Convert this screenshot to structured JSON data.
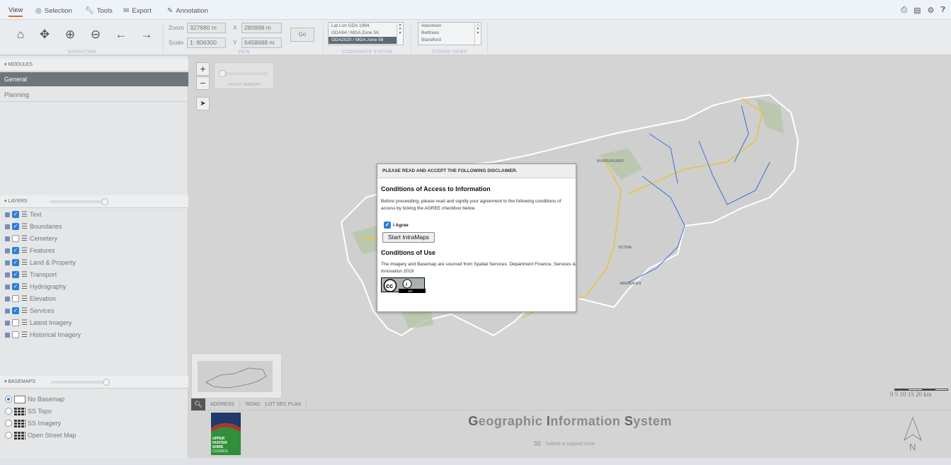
{
  "menu": {
    "items": [
      "View",
      "Selection",
      "Tools",
      "Export",
      "Annotation"
    ],
    "top_icons": [
      "print-icon",
      "clipboard-icon",
      "settings-icon",
      "help-icon"
    ]
  },
  "toolbar": {
    "navigation_caption": "NAVIGATION",
    "view_caption": "VIEW",
    "coord_caption": "COORDINATE SYSTEM",
    "stored_caption": "STORED VIEWS",
    "zoom_label": "Zoom",
    "zoom_value": "327680 m",
    "scale_label": "Scale",
    "scale_value": "1: 806300",
    "x_label": "X",
    "x_value": "280998 m",
    "y_label": "Y",
    "y_value": "6458688 m",
    "go_label": "Go",
    "coord_systems": [
      "Lat Lon GDA 1994",
      "GDA94 / MGA Zone 56",
      "GDA2020 / MGA zone 56"
    ],
    "coord_selected": "GDA2020 / MGA zone 56",
    "stored_views": [
      "Aberdeen",
      "Belltrees",
      "Blandford"
    ]
  },
  "modules": {
    "header": "MODULES",
    "items": [
      "General",
      "Planning"
    ],
    "selected": "General"
  },
  "layers": {
    "header": "LAYERS",
    "items": [
      {
        "label": "Text",
        "checked": true
      },
      {
        "label": "Boundaries",
        "checked": true
      },
      {
        "label": "Cemetery",
        "checked": false
      },
      {
        "label": "Features",
        "checked": true
      },
      {
        "label": "Land & Property",
        "checked": true
      },
      {
        "label": "Transport",
        "checked": true
      },
      {
        "label": "Hydrography",
        "checked": true
      },
      {
        "label": "Elevation",
        "checked": false
      },
      {
        "label": "Services",
        "checked": true
      },
      {
        "label": "Latest Imagery",
        "checked": false
      },
      {
        "label": "Historical Imagery",
        "checked": false
      }
    ]
  },
  "basemaps": {
    "header": "BASEMAPS",
    "items": [
      "No Basemap",
      "SS Topo",
      "SS Imagery",
      "Open Street Map"
    ],
    "selected": "No Basemap"
  },
  "map": {
    "imagery_label": "LATEST IMAGERY",
    "places": [
      "MURRURUNDI",
      "SCONE",
      "ABERDEEN"
    ],
    "scale_ticks": "0   5   10   15   20 km",
    "colors": {
      "boundary": "#ffffff",
      "roads": "#e8c33a",
      "rivers": "#3a6fd8",
      "vegetation": "#b7c4a6",
      "boundary_fill": "#cfcfcf"
    }
  },
  "modal": {
    "header": "PLEASE READ AND ACCEPT THE FOLLOWING DISCLAIMER.",
    "title1": "Conditions of Access to Information",
    "text1": "Before proceeding, please read and signify your agreement to the following conditions of access by ticking the AGREE checkbox below.",
    "agree_label": "I Agree",
    "agree_checked": true,
    "start_button": "Start IntraMaps",
    "title2": "Conditions of Use",
    "text2": "The Imagery and Basemap are sourced from Spatial Services. Department Finance, Services & Innovation 2019",
    "cc_text": "BY"
  },
  "search": {
    "tabs": [
      "ADDRESS",
      "ROAD",
      "LOT SEC PLAN"
    ]
  },
  "footer": {
    "title_parts": [
      "G",
      "eographic ",
      "I",
      "nformation ",
      "S",
      "ystem"
    ],
    "support_link": "Submit a support case",
    "logo_text": [
      "UPPER",
      "HUNTER",
      "SHIRE",
      "COUNCIL"
    ],
    "north_label": "N"
  }
}
